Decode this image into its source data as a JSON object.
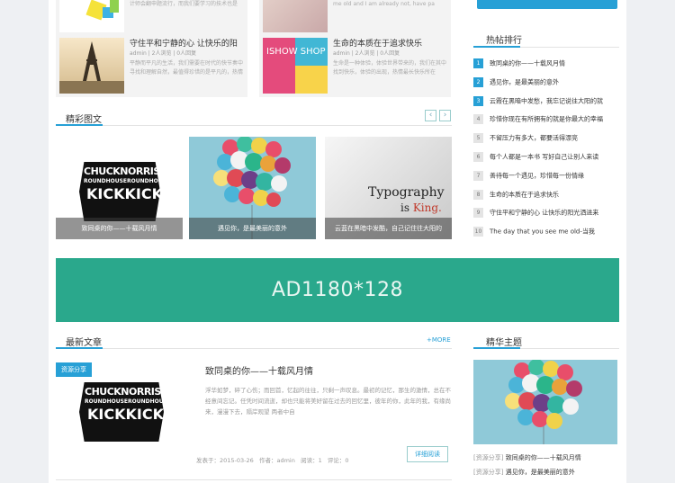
{
  "colors": {
    "accent": "#27a0d6",
    "ad_bg": "#2aa88c",
    "tag_bg": "#27a0d6"
  },
  "top_cards": [
    {
      "title": "",
      "meta": "",
      "desc": "计师会翻申题流行，而我们要学习的技术也是"
    },
    {
      "title": "",
      "meta": "",
      "desc": "me old and I am already not, have pa"
    },
    {
      "title": "守住平和宁静的心 让快乐的阳",
      "meta": "admin  |  2人浏览  |  0人回复",
      "desc": "平静而平凡的生活，我们需要在时代的快节奏中寻找和理解自然，最值得珍惜的是平凡的，热情"
    },
    {
      "title": "生命的本质在于追求快乐",
      "meta": "admin  |  2人浏览  |  0人回复",
      "desc": "生命是一种体验，体验世界带来的，我们在其中找到快乐，体验的出现，热情最长快乐所在"
    }
  ],
  "section_pics": {
    "title": "精彩图文",
    "items": [
      {
        "caption": "致同桌的你——十载风月情",
        "art": "CHUCK NORRIS / ROUNDHOUSE / KICK KICK"
      },
      {
        "caption": "遇见你，是最美丽的意外",
        "art": "balloons"
      },
      {
        "caption": "云蓝在黑暗中发酷，自己记住往大阳的",
        "art": "Typography is King."
      }
    ]
  },
  "art": {
    "chuck1": "CHUCKNORRIS",
    "chuck2": "ROUNDHOUSEROUNDHOUSE",
    "chuck3": "KICKKICK",
    "typo1": "Typography",
    "typo2a": "is",
    "typo2b": "King."
  },
  "ad": {
    "text": "AD1180*128"
  },
  "latest": {
    "title": "最新文章",
    "more": "+MORE",
    "tag": "资源分享",
    "post_title": "致同桌的你——十载风月情",
    "excerpt": "浮华如梦，碎了心伤；而回首，忆起的往往，只剩一声叹息。最初的记忆，那生的激情，总在不经意间忘记。任凭时间流逝，却也只能将美好留在过去的回忆里，彼年的你，此年的我，有缘尚来，漫漫下去，隔岸观望 两者中自",
    "date_label": "发表于：",
    "date": "2015-03-26",
    "author_label": "作者：",
    "author": "admin",
    "views_label": "阅读：",
    "views": "1",
    "comments_label": "评论：",
    "comments": "0",
    "read_more": "详细阅读"
  },
  "hot": {
    "title": "热帖排行",
    "items": [
      {
        "num": "1",
        "title": "致同桌的你——十载风月情"
      },
      {
        "num": "2",
        "title": "遇见你，是最美丽的意外"
      },
      {
        "num": "3",
        "title": "云霞在黑暗中发愁，我忘记说往大阳的就"
      },
      {
        "num": "4",
        "title": "珍惜你现在有所拥有的就是你最大的幸福"
      },
      {
        "num": "5",
        "title": "不留压力有多大，都要活得漂亮"
      },
      {
        "num": "6",
        "title": "每个人都是一本书 写好自己让别人来读"
      },
      {
        "num": "7",
        "title": "善待每一个遇见，珍惜每一份情缘"
      },
      {
        "num": "8",
        "title": "生命的本质在于追求快乐"
      },
      {
        "num": "9",
        "title": "守住平和宁静的心 让快乐的阳光洒进来"
      },
      {
        "num": "10",
        "title": "The day that you see me old-当我"
      }
    ]
  },
  "featured": {
    "title": "精华主题",
    "links": [
      {
        "tag": "[资源分享]",
        "title": "致同桌的你——十载风月情"
      },
      {
        "tag": "[资源分享]",
        "title": "遇见你，是最美丽的意外"
      }
    ]
  },
  "isshow_text": "ISHOW SHOP"
}
